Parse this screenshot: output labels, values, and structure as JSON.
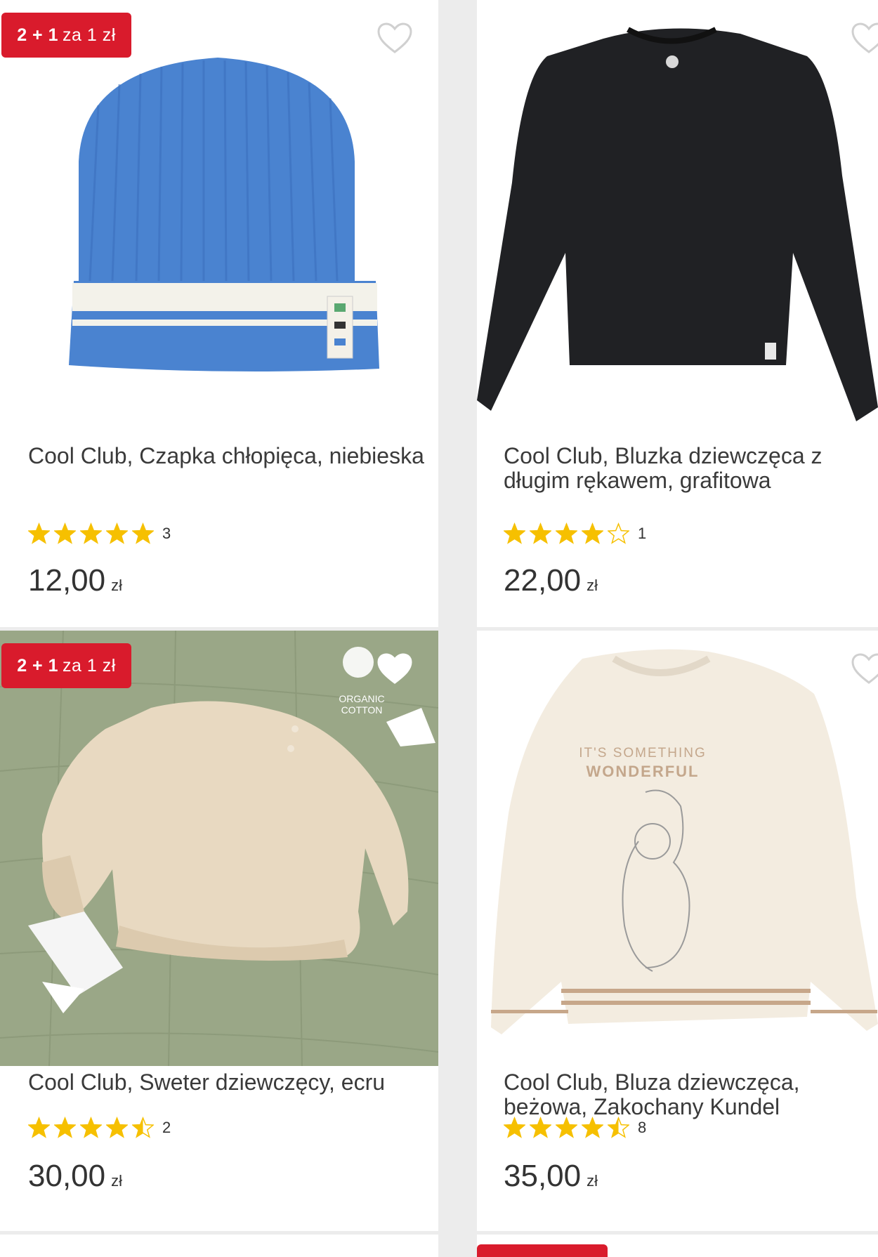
{
  "colors": {
    "accent": "#d91b2c",
    "star": "#f6c000",
    "page_bg": "#ececec"
  },
  "products": [
    {
      "badge_strong": "2 + 1",
      "badge_text": "za 1 zł",
      "title": "Cool Club, Czapka chłopięca, niebieska",
      "rating": 5,
      "rating_count": "3",
      "price": "12,00",
      "currency": "zł"
    },
    {
      "title": "Cool Club, Bluzka dziewczęca z długim rękawem, grafitowa",
      "rating": 4,
      "rating_count": "1",
      "price": "22,00",
      "currency": "zł"
    },
    {
      "badge_strong": "2 + 1",
      "badge_text": "za 1 zł",
      "title": "Cool Club, Sweter dziewczęcy, ecru",
      "rating": 4.5,
      "rating_count": "2",
      "price": "30,00",
      "currency": "zł",
      "image_text": [
        "ORGANIC",
        "COTTON"
      ]
    },
    {
      "title": "Cool Club, Bluza dziewczęca, beżowa, Zakochany Kundel",
      "rating": 4.5,
      "rating_count": "8",
      "price": "35,00",
      "currency": "zł",
      "image_text": [
        "IT'S SOMETHING",
        "WONDERFUL"
      ]
    }
  ]
}
